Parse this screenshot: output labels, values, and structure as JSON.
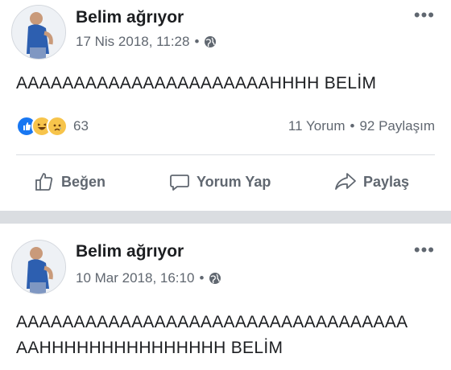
{
  "posts": [
    {
      "author": "Belim ağrıyor",
      "date": "17 Nis 2018, 11:28",
      "meta_sep": "•",
      "text": "AAAAAAAAAAAAAAAAAAAAAAHHHH BELİM",
      "reactions": {
        "icons": [
          "like-reaction-icon",
          "haha-reaction-icon",
          "sad-reaction-icon"
        ],
        "count": "63"
      },
      "comments": "11 Yorum",
      "stats_sep": "•",
      "shares": "92 Paylaşım",
      "actions": {
        "like": "Beğen",
        "comment": "Yorum Yap",
        "share": "Paylaş"
      }
    },
    {
      "author": "Belim ağrıyor",
      "date": "10 Mar 2018, 16:10",
      "meta_sep": "•",
      "text_line1": "AAAAAAAAAAAAAAAAAAAAAAAAAAAAAAAAAA",
      "text_line2": "AAHHHHHHHHHHHHHHH BELİM"
    }
  ],
  "colors": {
    "meta": "#606770",
    "like_blue": "#1877f2",
    "emoji_yellow": "#f7c44b",
    "separator": "#dadde1"
  }
}
